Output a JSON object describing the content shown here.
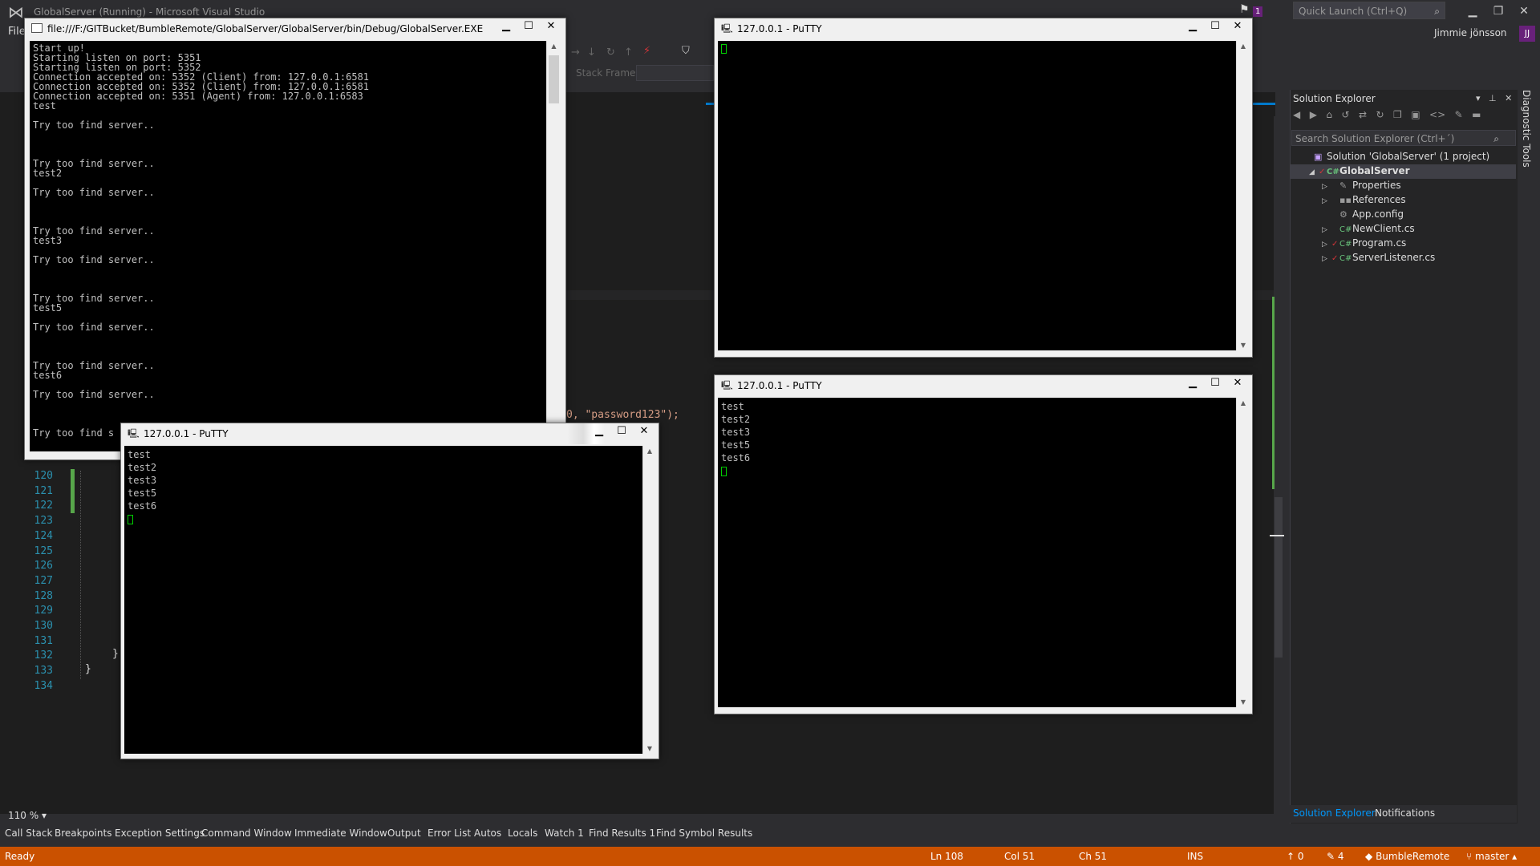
{
  "vs": {
    "title": "GlobalServer (Running) - Microsoft Visual Studio",
    "quick_launch_placeholder": "Quick Launch (Ctrl+Q)",
    "notification_count": "1",
    "menu_file": "File",
    "user_name": "Jimmie jönsson",
    "user_initials": "JJ",
    "stack_frame_label": "Stack Frame:",
    "zoom": "110 %"
  },
  "editor": {
    "line_numbers": [
      "120",
      "121",
      "122",
      "123",
      "124",
      "125",
      "126",
      "127",
      "128",
      "129",
      "130",
      "131",
      "132",
      "133",
      "134"
    ],
    "string_fragment": "0, \"password123\");",
    "brace1": "}",
    "brace2": "}"
  },
  "console": {
    "title": "file:///F:/GITBucket/BumbleRemote/GlobalServer/GlobalServer/bin/Debug/GlobalServer.EXE",
    "lines": [
      "Start up!",
      "Starting listen on port: 5351",
      "Starting listen on port: 5352",
      "Connection accepted on: 5352 (Client) from: 127.0.0.1:6581",
      "Connection accepted on: 5352 (Client) from: 127.0.0.1:6581",
      "Connection accepted on: 5351 (Agent) from: 127.0.0.1:6583",
      "test",
      "",
      "Try too find server..",
      "",
      "",
      "",
      "Try too find server..",
      "test2",
      "",
      "Try too find server..",
      "",
      "",
      "",
      "Try too find server..",
      "test3",
      "",
      "Try too find server..",
      "",
      "",
      "",
      "Try too find server..",
      "test5",
      "",
      "Try too find server..",
      "",
      "",
      "",
      "Try too find server..",
      "test6",
      "",
      "Try too find server..",
      "",
      "",
      "",
      "Try too find s"
    ]
  },
  "putty_top": {
    "title": "127.0.0.1 - PuTTY",
    "lines": []
  },
  "putty_right": {
    "title": "127.0.0.1 - PuTTY",
    "lines": [
      "test",
      "test2",
      "test3",
      "test5",
      "test6"
    ]
  },
  "putty_left": {
    "title": "127.0.0.1 - PuTTY",
    "lines": [
      "test",
      "test2",
      "test3",
      "test5",
      "test6"
    ]
  },
  "window_controls": {
    "minimize": "▁",
    "maximize": "☐",
    "close": "✕"
  },
  "solution_explorer": {
    "title": "Solution Explorer",
    "search_placeholder": "Search Solution Explorer (Ctrl+´)",
    "tree": [
      {
        "label": "Solution 'GlobalServer' (1 project)",
        "icon": "solution-icon",
        "level": 0,
        "arrow": ""
      },
      {
        "label": "GlobalServer",
        "icon": "csharp-project-icon",
        "level": 1,
        "arrow": "◢"
      },
      {
        "label": "Properties",
        "icon": "wrench-icon",
        "level": 2,
        "arrow": "▷"
      },
      {
        "label": "References",
        "icon": "references-icon",
        "level": 2,
        "arrow": "▷"
      },
      {
        "label": "App.config",
        "icon": "config-icon",
        "level": 2,
        "arrow": ""
      },
      {
        "label": "NewClient.cs",
        "icon": "csharp-file-icon",
        "level": 2,
        "arrow": "▷"
      },
      {
        "label": "Program.cs",
        "icon": "csharp-file-icon",
        "level": 2,
        "arrow": "▷"
      },
      {
        "label": "ServerListener.cs",
        "icon": "csharp-file-icon",
        "level": 2,
        "arrow": "▷"
      }
    ],
    "tab_active": "Solution Explorer",
    "tab_other": "Notifications",
    "side_tab": "Diagnostic Tools"
  },
  "bottom_tabs": [
    "Call Stack",
    "Breakpoints",
    "Exception Settings",
    "Command Window",
    "Immediate Window",
    "Output",
    "Error List",
    "Autos",
    "Locals",
    "Watch 1",
    "Find Results 1",
    "Find Symbol Results"
  ],
  "status": {
    "ready": "Ready",
    "ln": "Ln 108",
    "col": "Col 51",
    "ch": "Ch 51",
    "ins": "INS",
    "push": "0",
    "changes": "4",
    "repo": "BumbleRemote",
    "branch": "master"
  },
  "colors": {
    "status_bar": "#ca5100",
    "accent": "#007acc"
  }
}
